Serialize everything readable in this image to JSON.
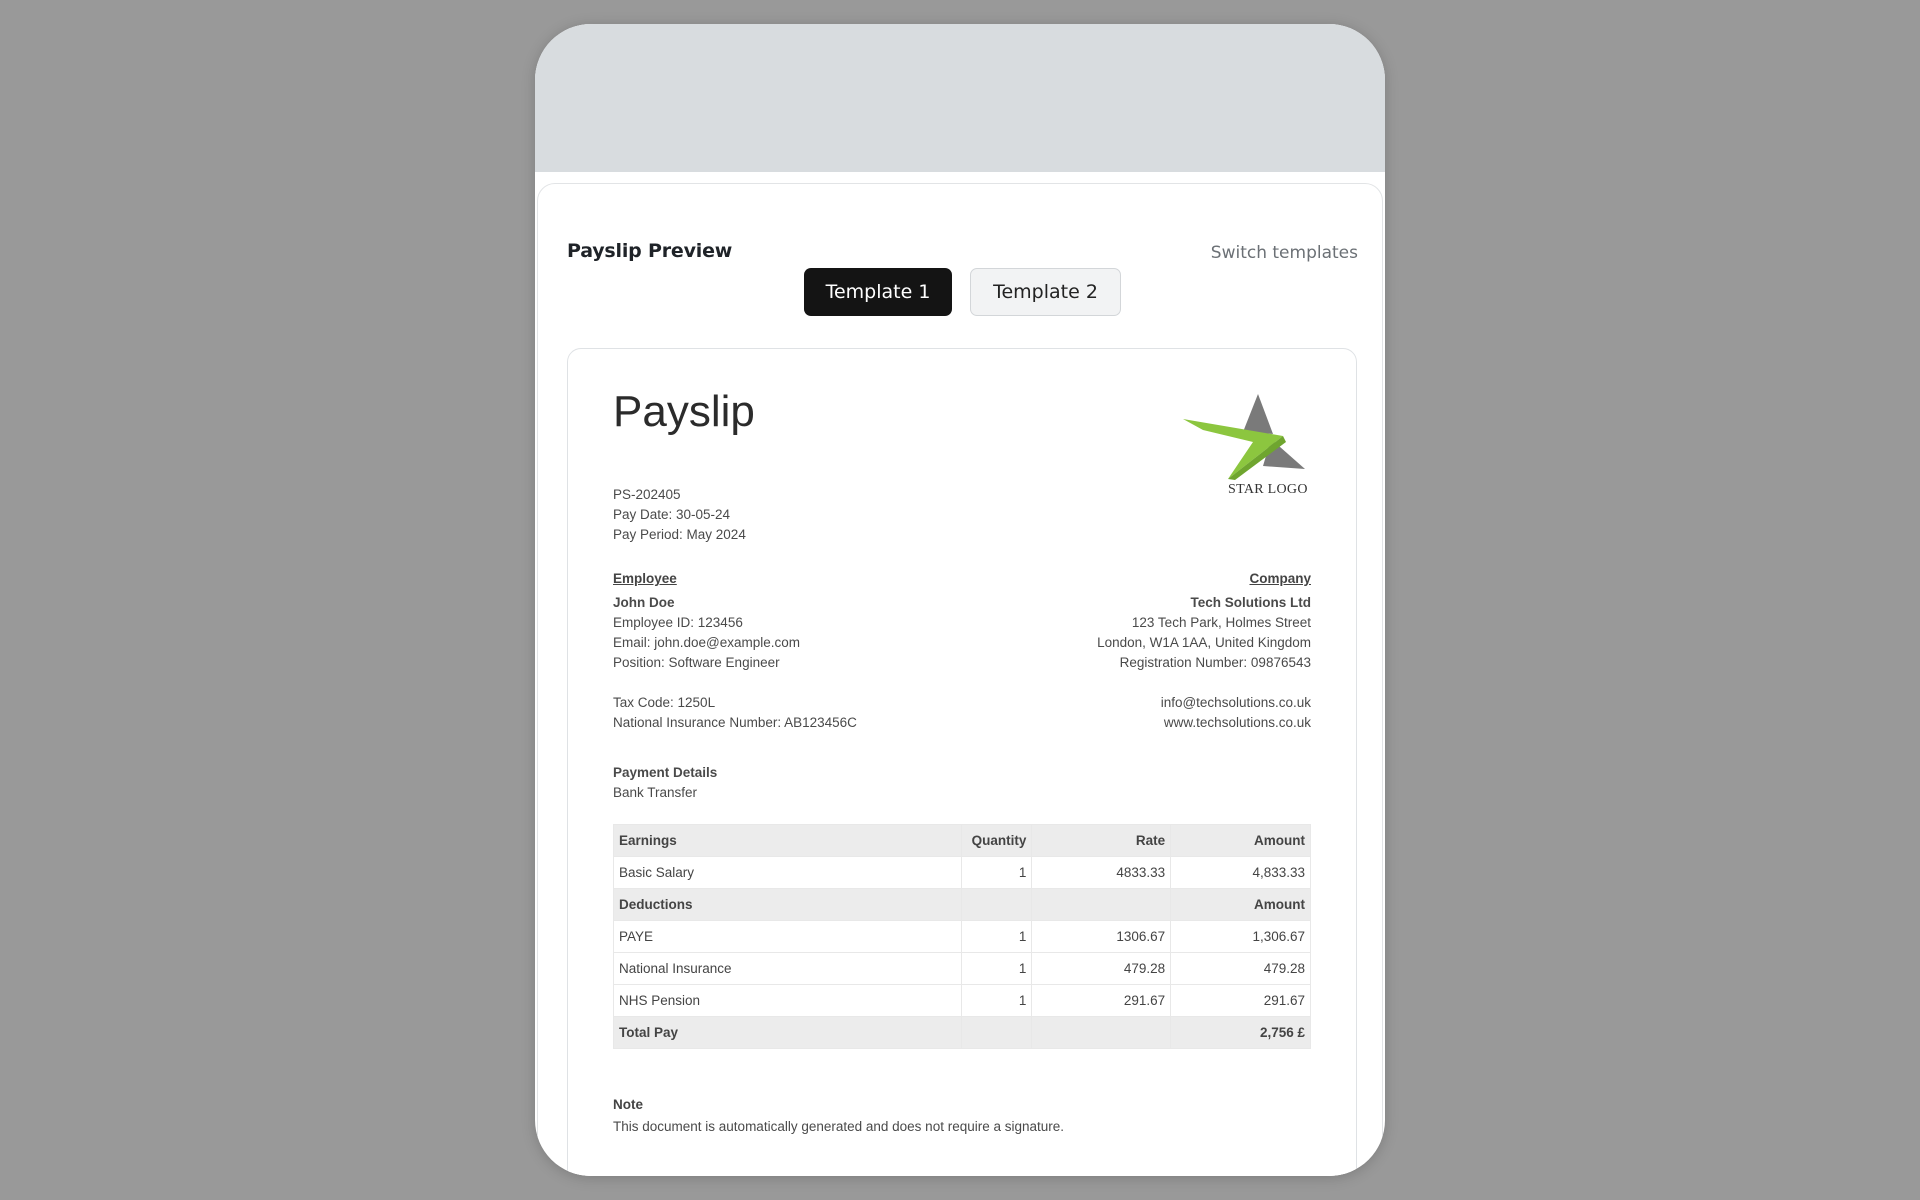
{
  "header": {
    "title": "Payslip Preview",
    "switch_label": "Switch templates"
  },
  "tabs": [
    {
      "label": "Template 1",
      "active": true
    },
    {
      "label": "Template 2",
      "active": false
    }
  ],
  "payslip": {
    "title": "Payslip",
    "number": "PS-202405",
    "pay_date": "Pay Date: 30-05-24",
    "pay_period": "Pay Period: May 2024",
    "logo_text": "STAR LOGO",
    "employee": {
      "heading": "Employee",
      "name": "John Doe",
      "id": "Employee ID: 123456",
      "email": "Email: john.doe@example.com",
      "position": "Position: Software Engineer",
      "tax_code": "Tax Code: 1250L",
      "ni_number": "National Insurance Number: AB123456C"
    },
    "company": {
      "heading": "Company",
      "name": "Tech Solutions Ltd",
      "address1": "123 Tech Park, Holmes Street",
      "address2": "London, W1A 1AA, United Kingdom",
      "registration": "Registration Number: 09876543",
      "email": "info@techsolutions.co.uk",
      "website": "www.techsolutions.co.uk"
    },
    "payment": {
      "heading": "Payment Details",
      "method": "Bank Transfer"
    },
    "earnings_header": {
      "label": "Earnings",
      "quantity": "Quantity",
      "rate": "Rate",
      "amount": "Amount"
    },
    "earnings": [
      {
        "label": "Basic Salary",
        "quantity": "1",
        "rate": "4833.33",
        "amount": "4,833.33"
      }
    ],
    "deductions_header": {
      "label": "Deductions",
      "amount": "Amount"
    },
    "deductions": [
      {
        "label": "PAYE",
        "quantity": "1",
        "rate": "1306.67",
        "amount": "1,306.67"
      },
      {
        "label": "National Insurance",
        "quantity": "1",
        "rate": "479.28",
        "amount": "479.28"
      },
      {
        "label": "NHS Pension",
        "quantity": "1",
        "rate": "291.67",
        "amount": "291.67"
      }
    ],
    "total": {
      "label": "Total Pay",
      "amount": "2,756 £"
    },
    "note": {
      "heading": "Note",
      "text": "This document is automatically generated and does not require a signature."
    }
  },
  "colors": {
    "logo_green": "#8cc63f",
    "logo_gray": "#7a7a7a",
    "active_tab": "#141414"
  }
}
